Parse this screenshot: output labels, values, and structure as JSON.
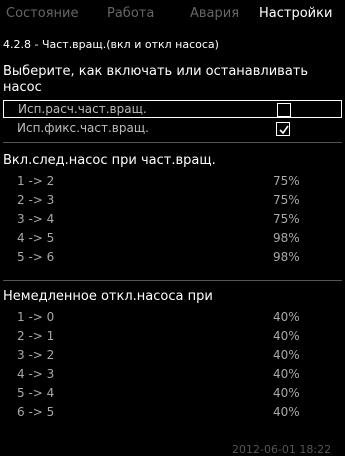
{
  "tabs": [
    {
      "label": "Состояние",
      "active": false
    },
    {
      "label": "Работа",
      "active": false
    },
    {
      "label": "Авария",
      "active": false
    },
    {
      "label": "Настройки",
      "active": true
    }
  ],
  "subtitle": "4.2.8 - Част.вращ.(вкл и откл насоса)",
  "prompt": "Выберите, как включать или останавливать насос",
  "options": [
    {
      "label": "Исп.расч.част.вращ.",
      "checked": false,
      "selected": true
    },
    {
      "label": "Исп.фикс.част.вращ.",
      "checked": true,
      "selected": false
    }
  ],
  "section_on": {
    "title": "Вкл.след.насос при част.вращ.",
    "rows": [
      {
        "key": "1 -> 2",
        "value": "75%"
      },
      {
        "key": "2 -> 3",
        "value": "75%"
      },
      {
        "key": "3 -> 4",
        "value": "75%"
      },
      {
        "key": "4 -> 5",
        "value": "98%"
      },
      {
        "key": "5 -> 6",
        "value": "98%"
      }
    ]
  },
  "section_off": {
    "title": "Немедленное откл.насоса при",
    "rows": [
      {
        "key": "1 -> 0",
        "value": "40%"
      },
      {
        "key": "2 -> 1",
        "value": "40%"
      },
      {
        "key": "3 -> 2",
        "value": "40%"
      },
      {
        "key": "4 -> 3",
        "value": "40%"
      },
      {
        "key": "5 -> 4",
        "value": "40%"
      },
      {
        "key": "6 -> 5",
        "value": "40%"
      }
    ]
  },
  "timestamp": "2012-06-01 18:22"
}
